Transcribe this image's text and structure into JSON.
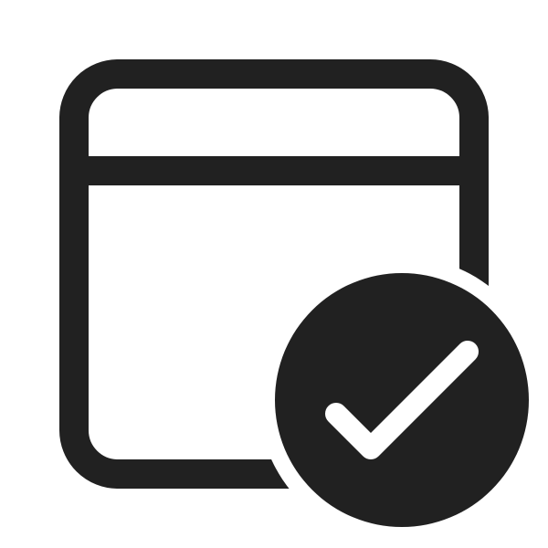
{
  "icon": {
    "name": "window-checkmark-icon",
    "parts": [
      "window-frame",
      "title-bar-divider",
      "checkmark-badge"
    ],
    "colors": {
      "ink": "#212121",
      "background": "#ffffff",
      "check": "#ffffff"
    }
  }
}
